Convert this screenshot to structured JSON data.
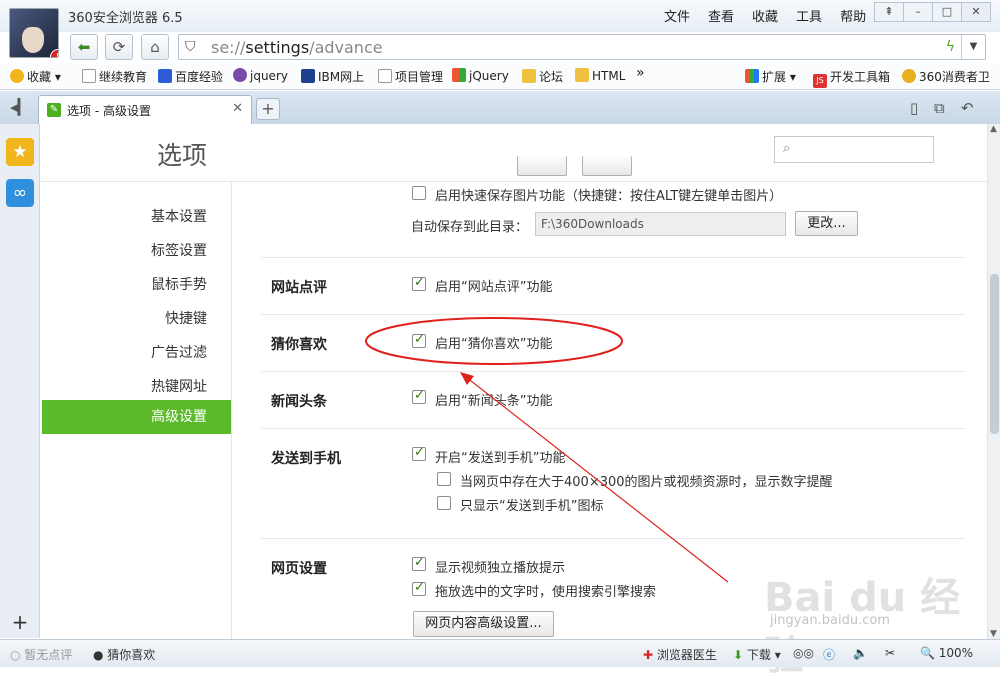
{
  "window": {
    "app_name": "360安全浏览器 6.5",
    "avatar_badge": "!"
  },
  "menu": [
    "文件",
    "查看",
    "收藏",
    "工具",
    "帮助"
  ],
  "window_buttons": [
    "⇞",
    "–",
    "□",
    "✕"
  ],
  "address": {
    "scheme": "se://",
    "host": "settings",
    "path": "/advance"
  },
  "bookmarks": [
    {
      "label": "收藏",
      "icon": "star-icon"
    },
    {
      "label": "继续教育",
      "icon": "page-icon"
    },
    {
      "label": "百度经验",
      "icon": "paw-icon"
    },
    {
      "label": "jquery",
      "icon": "gear-icon"
    },
    {
      "label": "IBM网上",
      "icon": "ibm-icon"
    },
    {
      "label": "项目管理",
      "icon": "page-icon"
    },
    {
      "label": "jQuery",
      "icon": "puzzle-icon"
    },
    {
      "label": "论坛",
      "icon": "folder-icon"
    },
    {
      "label": "HTML",
      "icon": "folder-icon"
    }
  ],
  "bookmark_more": "»",
  "extensions": [
    {
      "label": "扩展",
      "icon": "extension-icon"
    },
    {
      "label": "开发工具箱",
      "icon": "js-icon"
    },
    {
      "label": "360消费者卫",
      "icon": "shield-icon"
    }
  ],
  "tab": {
    "label": "选项 - 高级设置",
    "close": "✕",
    "new": "+"
  },
  "sidebar_add": "+",
  "page": {
    "title": "选项",
    "search_placeholder": ""
  },
  "nav": [
    "基本设置",
    "标签设置",
    "鼠标手势",
    "快捷键",
    "广告过滤",
    "热键网址",
    "高级设置"
  ],
  "active_nav": "高级设置",
  "image_save": {
    "quick_save_label": "启用快速保存图片功能（快捷键：按住ALT键左键单击图片）",
    "dir_label": "自动保存到此目录：",
    "dir_value": "F:\\360Downloads",
    "change_button": "更改..."
  },
  "sections": {
    "site_review": {
      "title": "网站点评",
      "option": "启用“网站点评”功能"
    },
    "guess": {
      "title": "猜你喜欢",
      "option": "启用“猜你喜欢”功能"
    },
    "news": {
      "title": "新闻头条",
      "option": "启用“新闻头条”功能"
    },
    "send_phone": {
      "title": "发送到手机",
      "option": "开启“发送到手机”功能",
      "sub1": "当网页中存在大于400×300的图片或视频资源时，显示数字提醒",
      "sub2": "只显示“发送到手机”图标"
    },
    "webpage": {
      "title": "网页设置",
      "opt1": "显示视频独立播放提示",
      "opt2": "拖放选中的文字时，使用搜索引擎搜索",
      "advanced_button": "网页内容高级设置..."
    }
  },
  "checkboxes": {
    "quick_save": false,
    "site_review": true,
    "guess": true,
    "news": true,
    "send_phone": true,
    "sub1": false,
    "sub2": false,
    "video_tip": true,
    "drag_search": true
  },
  "status": {
    "left1": "暂无点评",
    "left2": "猜你喜欢",
    "doctor": "浏览器医生",
    "download": "下载",
    "zoom": "100%"
  },
  "watermark": {
    "logo": "Bai du 经验",
    "url": "jingyan.baidu.com"
  },
  "colors": {
    "accent": "#5cba2a",
    "annotation": "#e0201c"
  }
}
